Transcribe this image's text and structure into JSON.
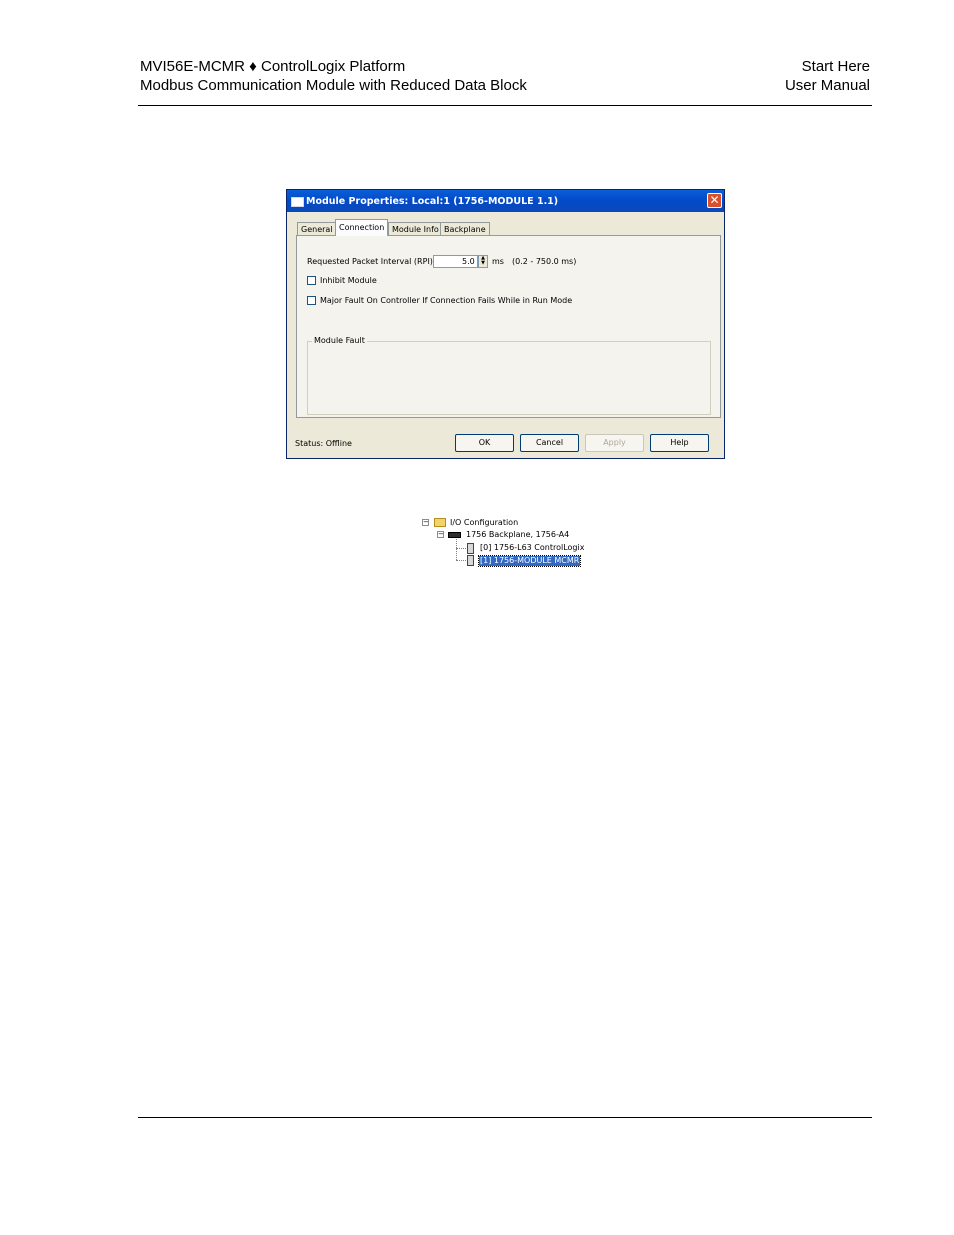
{
  "header": {
    "left_line1": "MVI56E-MCMR ♦ ControlLogix Platform",
    "left_line2": "Modbus Communication Module with Reduced Data Block",
    "right_line1": "Start Here",
    "right_line2": "User Manual"
  },
  "dialog": {
    "title": "Module Properties: Local:1 (1756-MODULE 1.1)",
    "tabs": [
      {
        "label": "General",
        "active": false
      },
      {
        "label": "Connection",
        "active": true
      },
      {
        "label": "Module Info",
        "active": false
      },
      {
        "label": "Backplane",
        "active": false
      }
    ],
    "rpi_label": "Requested Packet Interval (RPI):",
    "rpi_value": "5.0",
    "rpi_unit": "ms",
    "rpi_range": "(0.2 - 750.0 ms)",
    "inhibit_label": "Inhibit Module",
    "inhibit_checked": false,
    "major_fault_label": "Major Fault On Controller If Connection Fails While in Run Mode",
    "major_fault_checked": false,
    "module_fault_label": "Module Fault",
    "status_text": "Status:  Offline",
    "buttons": {
      "ok": "OK",
      "cancel": "Cancel",
      "apply": "Apply",
      "help": "Help"
    },
    "close_glyph": "✕"
  },
  "tree": {
    "root": "I/O Configuration",
    "backplane": "1756 Backplane, 1756-A4",
    "slot0": "[0] 1756-L63 ControlLogix",
    "slot1": "[1] 1756-MODULE MCMR"
  },
  "colors": {
    "titlebar": "#0349c8",
    "selection": "#316ac5",
    "dialog_bg": "#ece9d8"
  }
}
